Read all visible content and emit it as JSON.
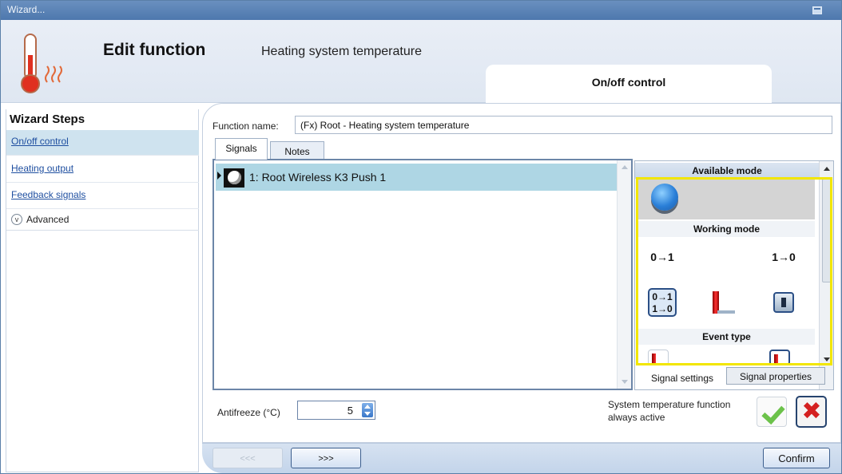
{
  "window": {
    "title": "Wizard..."
  },
  "header": {
    "title": "Edit function",
    "subtitle": "Heating system temperature",
    "step_tab": "On/off control"
  },
  "sidebar": {
    "heading": "Wizard Steps",
    "items": [
      {
        "label": "On/off control",
        "active": true
      },
      {
        "label": "Heating output",
        "active": false
      },
      {
        "label": "Feedback signals",
        "active": false
      }
    ],
    "advanced_label": "Advanced"
  },
  "form": {
    "function_name_label": "Function name:",
    "function_name_value": "(Fx) Root - Heating system temperature"
  },
  "tabs": [
    {
      "label": "Signals",
      "active": true
    },
    {
      "label": "Notes",
      "active": false
    }
  ],
  "signals": [
    {
      "label": "1: Root Wireless K3 Push 1",
      "selected": true
    }
  ],
  "mode_panel": {
    "available_mode": "Available mode",
    "working_mode": "Working mode",
    "event_type": "Event type",
    "buttons": {
      "rise": "0→1",
      "fall": "1→0",
      "both_top": "0→1",
      "both_bottom": "1→0"
    },
    "sub_tabs": [
      "Signal settings",
      "Signal properties"
    ]
  },
  "antifreeze": {
    "label": "Antifreeze (°C)",
    "value": "5"
  },
  "system_temp": {
    "label": "System temperature function always active"
  },
  "footer": {
    "prev": "<<<",
    "next": ">>>",
    "confirm": "Confirm"
  },
  "colors": {
    "highlight_border": "#f2e600",
    "selected_row": "#aed6e4",
    "title_bar": "#5a82b4"
  }
}
